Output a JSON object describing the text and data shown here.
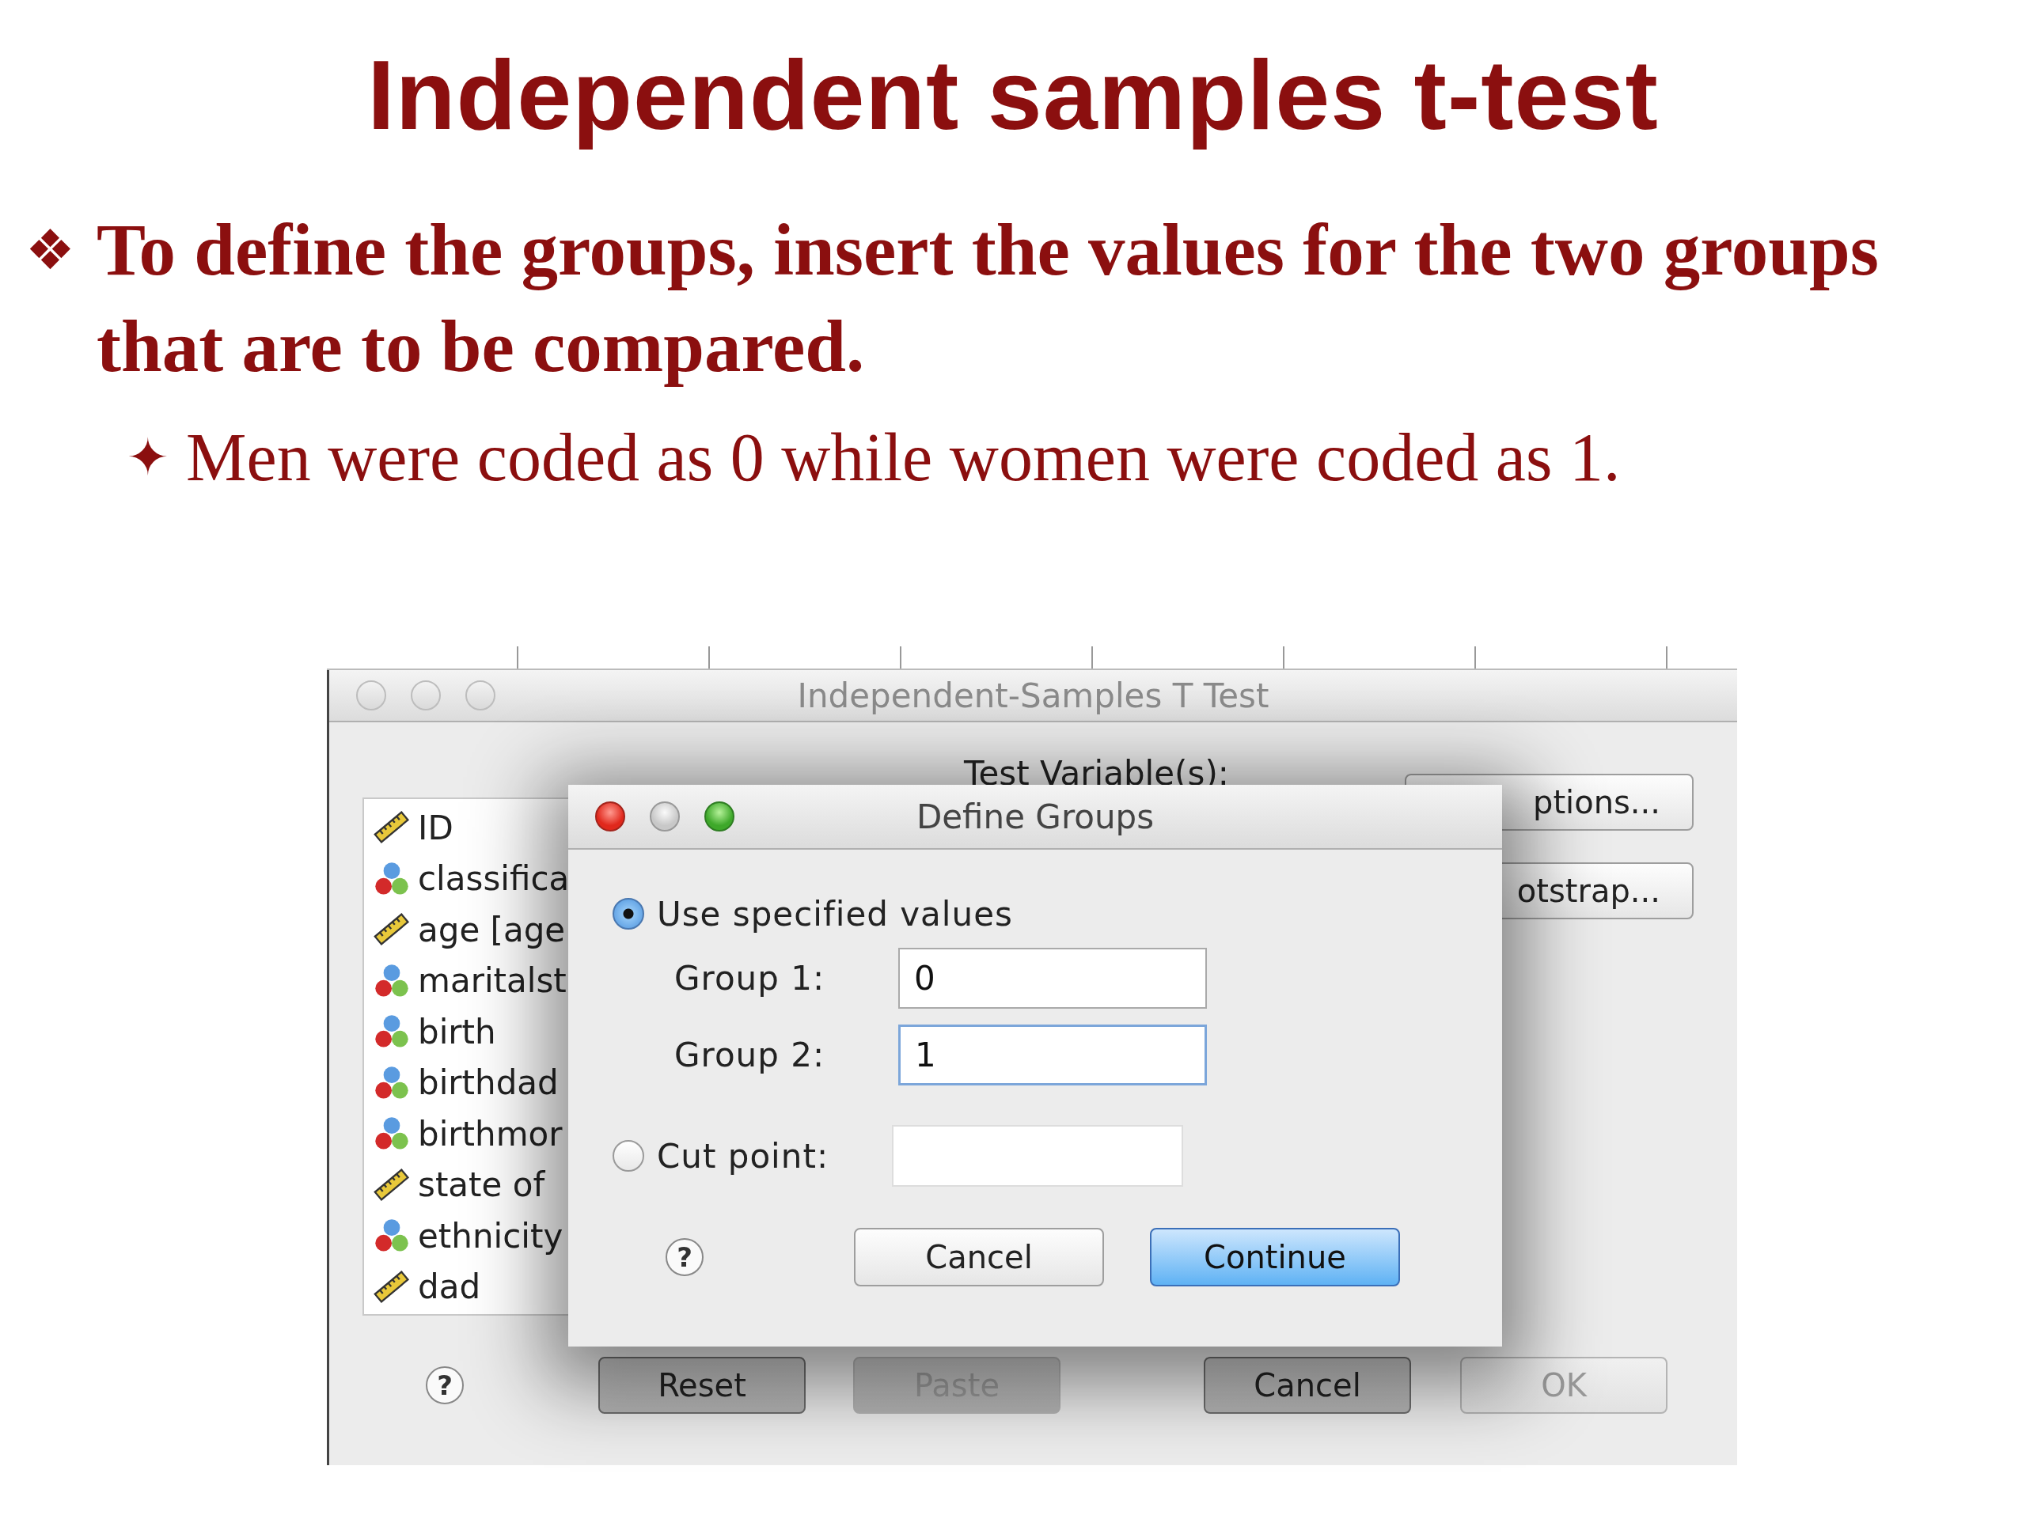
{
  "title": "Independent samples t-test",
  "bullets": [
    {
      "marker": "❖",
      "text": "To define the groups, insert the values for the two groups that are to be compared.",
      "children": [
        {
          "marker": "✦",
          "text": "Men were coded as 0 while women were coded as 1."
        }
      ]
    }
  ],
  "screenshot": {
    "main_window": {
      "title": "Independent-Samples T Test",
      "active": false,
      "variables": [
        {
          "name": "ID",
          "kind": "scale"
        },
        {
          "name": "classifica",
          "kind": "nominal"
        },
        {
          "name": "age [age",
          "kind": "scale"
        },
        {
          "name": "maritalst",
          "kind": "nominal"
        },
        {
          "name": "birth",
          "kind": "nominal"
        },
        {
          "name": "birthdad",
          "kind": "nominal"
        },
        {
          "name": "birthmor",
          "kind": "nominal"
        },
        {
          "name": "state of",
          "kind": "scale"
        },
        {
          "name": "ethnicity",
          "kind": "nominal"
        },
        {
          "name": "dad",
          "kind": "scale"
        }
      ],
      "test_variables_label": "Test Variable(s):",
      "side_buttons": [
        "ptions...",
        "otstrap..."
      ],
      "buttons": [
        {
          "label": "?",
          "kind": "help",
          "disabled": false
        },
        {
          "label": "Reset",
          "kind": "push",
          "disabled": false
        },
        {
          "label": "Paste",
          "kind": "push",
          "disabled": true
        },
        {
          "label": "Cancel",
          "kind": "push",
          "disabled": false
        },
        {
          "label": "OK",
          "kind": "push",
          "disabled": true
        }
      ]
    },
    "dialog": {
      "title": "Define Groups",
      "active": true,
      "options": [
        {
          "label": "Use specified values",
          "selected": true
        },
        {
          "label": "Cut point:",
          "selected": false
        }
      ],
      "groups": [
        {
          "label": "Group 1:",
          "value": "0",
          "focused": false
        },
        {
          "label": "Group 2:",
          "value": "1",
          "focused": true
        }
      ],
      "cut_point": {
        "disabled": true
      },
      "buttons": [
        {
          "label": "?",
          "kind": "help",
          "default": false
        },
        {
          "label": "Cancel",
          "kind": "push",
          "default": false
        },
        {
          "label": "Continue",
          "kind": "push",
          "default": true
        }
      ]
    }
  }
}
